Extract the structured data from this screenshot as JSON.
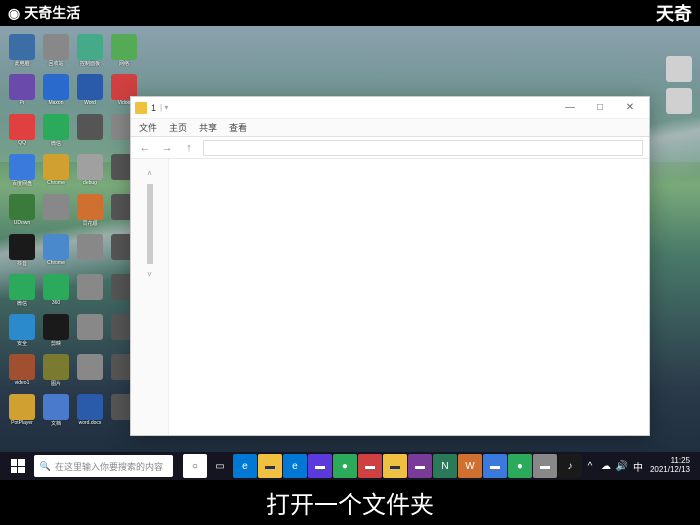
{
  "watermark": {
    "left": "天奇生活",
    "right": "天奇"
  },
  "caption": "打开一个文件夹",
  "desktop_icons": [
    {
      "label": "此电脑",
      "bg": "#3a6ea5"
    },
    {
      "label": "回收站",
      "bg": "#888"
    },
    {
      "label": "控制面板",
      "bg": "#4a8"
    },
    {
      "label": "网络",
      "bg": "#5a5"
    },
    {
      "label": "Pr",
      "bg": "#6a4aaa"
    },
    {
      "label": "Maxon",
      "bg": "#2a6acc"
    },
    {
      "label": "Word",
      "bg": "#2a5aaa"
    },
    {
      "label": "Vidoe",
      "bg": "#d04040"
    },
    {
      "label": "QQ",
      "bg": "#e04040"
    },
    {
      "label": "微信",
      "bg": "#2aaa5a"
    },
    {
      "label": "",
      "bg": "#555"
    },
    {
      "label": "",
      "bg": "#888"
    },
    {
      "label": "百度网盘",
      "bg": "#3a7add"
    },
    {
      "label": "Chrome",
      "bg": "#d0a030"
    },
    {
      "label": "debug",
      "bg": "#a0a0a0"
    },
    {
      "label": "",
      "bg": "#555"
    },
    {
      "label": "UDown",
      "bg": "#3a7a3a"
    },
    {
      "label": "",
      "bg": "#888"
    },
    {
      "label": "同花顺",
      "bg": "#d07030"
    },
    {
      "label": "",
      "bg": "#555"
    },
    {
      "label": "抖音",
      "bg": "#1a1a1a"
    },
    {
      "label": "Chrome",
      "bg": "#4a8acc"
    },
    {
      "label": "",
      "bg": "#888"
    },
    {
      "label": "",
      "bg": "#555"
    },
    {
      "label": "微信",
      "bg": "#2aaa5a"
    },
    {
      "label": "360",
      "bg": "#2aaa5a"
    },
    {
      "label": "",
      "bg": "#888"
    },
    {
      "label": "",
      "bg": "#555"
    },
    {
      "label": "安全",
      "bg": "#2a8acc"
    },
    {
      "label": "剪映",
      "bg": "#1a1a1a"
    },
    {
      "label": "",
      "bg": "#888"
    },
    {
      "label": "",
      "bg": "#555"
    },
    {
      "label": "video1",
      "bg": "#a05030"
    },
    {
      "label": "图片",
      "bg": "#7a7a30"
    },
    {
      "label": "",
      "bg": "#888"
    },
    {
      "label": "",
      "bg": "#555"
    },
    {
      "label": "PotPlayer",
      "bg": "#d0a030"
    },
    {
      "label": "文档",
      "bg": "#4a7acc"
    },
    {
      "label": "word.docx",
      "bg": "#2a5aaa"
    },
    {
      "label": "",
      "bg": "#555"
    }
  ],
  "right_icons": [
    {
      "label": "",
      "bg": "#d0d0d0"
    },
    {
      "label": "",
      "bg": "#d0d0d0"
    }
  ],
  "explorer": {
    "title": "1",
    "ribbon": [
      "文件",
      "主页",
      "共享",
      "查看"
    ],
    "address": "",
    "min": "—",
    "max": "□",
    "close": "✕"
  },
  "taskbar": {
    "search_placeholder": "在这里输入你要搜索的内容",
    "icons": [
      {
        "bg": "#fff",
        "c": "#333",
        "t": "○"
      },
      {
        "bg": "transparent",
        "c": "#fff",
        "t": "▭"
      },
      {
        "bg": "#0078d4",
        "c": "#fff",
        "t": "e"
      },
      {
        "bg": "#f0c040",
        "c": "#333",
        "t": "▬"
      },
      {
        "bg": "#0078d4",
        "c": "#fff",
        "t": "e"
      },
      {
        "bg": "#5a3add",
        "c": "#fff",
        "t": "▬"
      },
      {
        "bg": "#2aaa5a",
        "c": "#fff",
        "t": "●"
      },
      {
        "bg": "#d04040",
        "c": "#fff",
        "t": "▬"
      },
      {
        "bg": "#f0c040",
        "c": "#333",
        "t": "▬"
      },
      {
        "bg": "#7a3a9a",
        "c": "#fff",
        "t": "▬"
      },
      {
        "bg": "#2a7a5a",
        "c": "#fff",
        "t": "N"
      },
      {
        "bg": "#d07030",
        "c": "#fff",
        "t": "W"
      },
      {
        "bg": "#3a7add",
        "c": "#fff",
        "t": "▬"
      },
      {
        "bg": "#2aaa5a",
        "c": "#fff",
        "t": "●"
      },
      {
        "bg": "#888",
        "c": "#fff",
        "t": "▬"
      },
      {
        "bg": "#1a1a1a",
        "c": "#fff",
        "t": "♪"
      }
    ],
    "tray_icons": [
      "^",
      "☁",
      "🔊",
      "中"
    ],
    "time": "11:25",
    "date": "2021/12/13"
  }
}
